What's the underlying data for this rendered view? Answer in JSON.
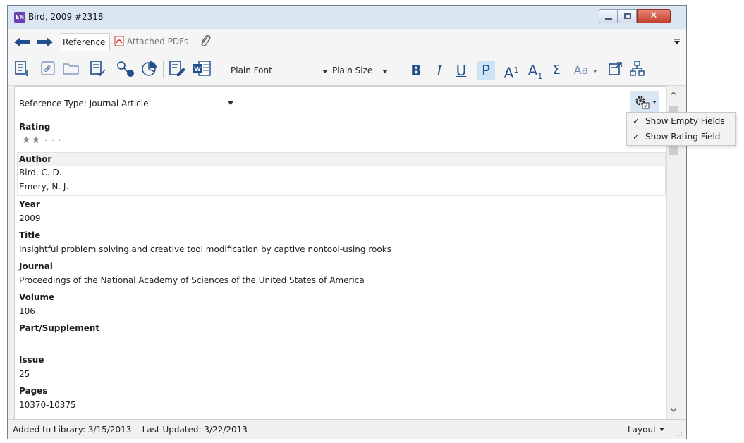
{
  "window": {
    "app_badge": "EN",
    "title": "Bird, 2009 #2318",
    "close_glyph": "✕"
  },
  "tabs": {
    "reference": "Reference",
    "attached_pdfs": "Attached PDFs"
  },
  "toolbar": {
    "font_name": "Plain Font",
    "font_size": "Plain Size",
    "bold": "B",
    "italic": "I",
    "underline": "U",
    "plain": "P",
    "superscript": "A",
    "superscript_mark": "1",
    "subscript": "A",
    "subscript_mark": "1",
    "symbol": "Σ",
    "case": "Aa"
  },
  "reference": {
    "type_label": "Reference Type: Journal Article",
    "rating_label": "Rating",
    "rating_value": 2,
    "rating_max": 5,
    "fields": [
      {
        "label": "Author",
        "values": [
          "Bird, C. D.",
          "Emery, N. J."
        ]
      },
      {
        "label": "Year",
        "values": [
          "2009"
        ]
      },
      {
        "label": "Title",
        "values": [
          "Insightful problem solving and creative tool modification by captive nontool-using rooks"
        ]
      },
      {
        "label": "Journal",
        "values": [
          "Proceedings of the National Academy of Sciences of the United States of America"
        ]
      },
      {
        "label": "Volume",
        "values": [
          "106"
        ]
      },
      {
        "label": "Part/Supplement",
        "values": [
          ""
        ]
      },
      {
        "label": "Issue",
        "values": [
          "25"
        ]
      },
      {
        "label": "Pages",
        "values": [
          "10370-10375"
        ]
      }
    ]
  },
  "menu": {
    "items": [
      {
        "label": "Show Empty Fields",
        "checked": true
      },
      {
        "label": "Show Rating Field",
        "checked": true
      }
    ],
    "check_glyph": "✓"
  },
  "status": {
    "text": "Added to Library: 3/15/2013    Last Updated: 3/22/2013",
    "layout_label": "Layout"
  },
  "colors": {
    "accent": "#1f4f8c",
    "title_bar": "#dbe6f3",
    "close_button": "#c4402d"
  }
}
